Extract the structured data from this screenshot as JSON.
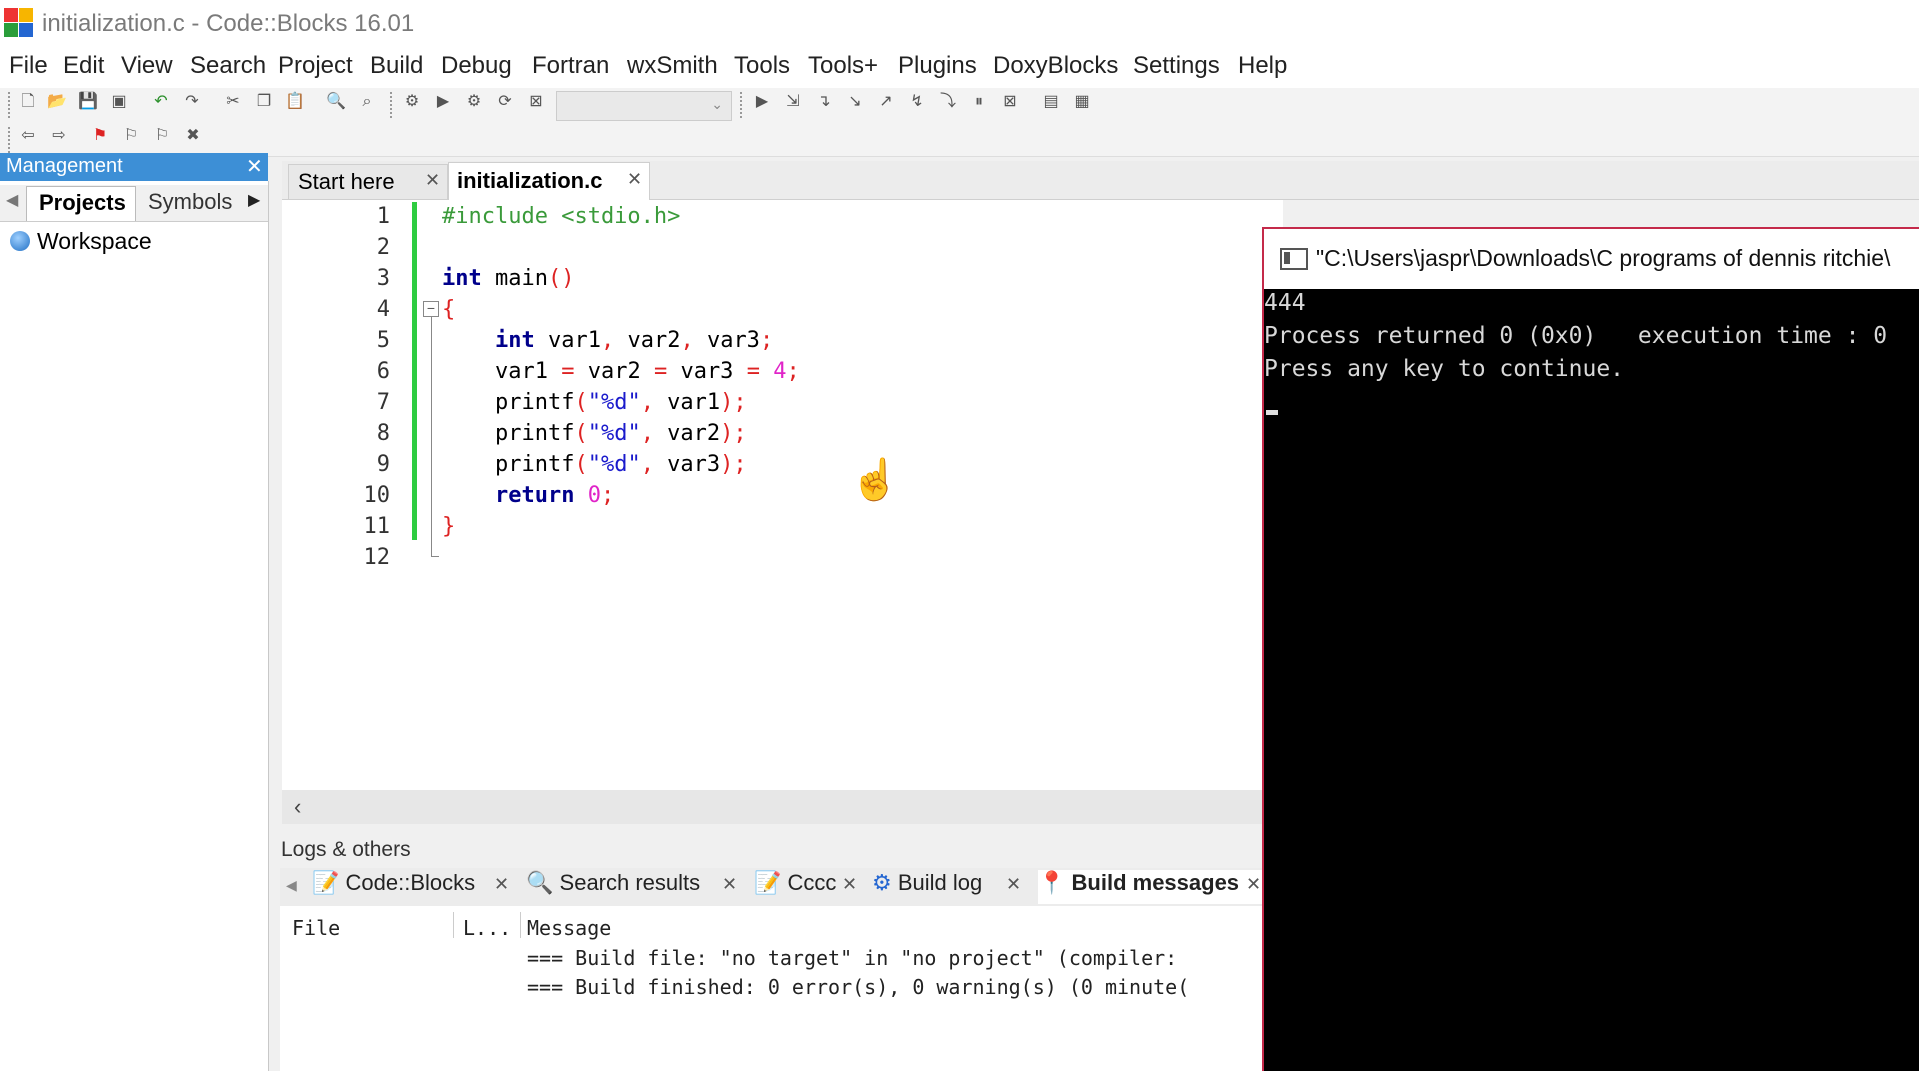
{
  "window": {
    "title": "initialization.c - Code::Blocks 16.01"
  },
  "menu": [
    "File",
    "Edit",
    "View",
    "Search",
    "Project",
    "Build",
    "Debug",
    "Fortran",
    "wxSmith",
    "Tools",
    "Tools+",
    "Plugins",
    "DoxyBlocks",
    "Settings",
    "Help"
  ],
  "management": {
    "title": "Management",
    "tabs": [
      "Projects",
      "Symbols"
    ],
    "active_tab": "Projects",
    "tree": {
      "workspace": "Workspace"
    }
  },
  "editor": {
    "tabs": [
      {
        "label": "Start here"
      },
      {
        "label": "initialization.c",
        "active": true
      }
    ],
    "line_numbers": [
      "1",
      "2",
      "3",
      "4",
      "5",
      "6",
      "7",
      "8",
      "9",
      "10",
      "11",
      "12"
    ]
  },
  "logs": {
    "title": "Logs & others",
    "tabs": [
      "Code::Blocks",
      "Search results",
      "Cccc",
      "Build log",
      "Build messages"
    ],
    "active_tab": "Build messages",
    "columns": [
      "File",
      "L...",
      "Message"
    ],
    "rows": [
      "=== Build file: \"no target\" in \"no project\" (compiler:",
      "=== Build finished: 0 error(s), 0 warning(s) (0 minute("
    ]
  },
  "console": {
    "title": "\"C:\\Users\\jaspr\\Downloads\\C programs of dennis ritchie\\",
    "lines": [
      "444",
      "Process returned 0 (0x0)   execution time : 0",
      "Press any key to continue."
    ]
  },
  "colors": {
    "accent": "#3d8fd6",
    "console_border": "#c42a4a",
    "change_bar": "#2ecc40"
  }
}
